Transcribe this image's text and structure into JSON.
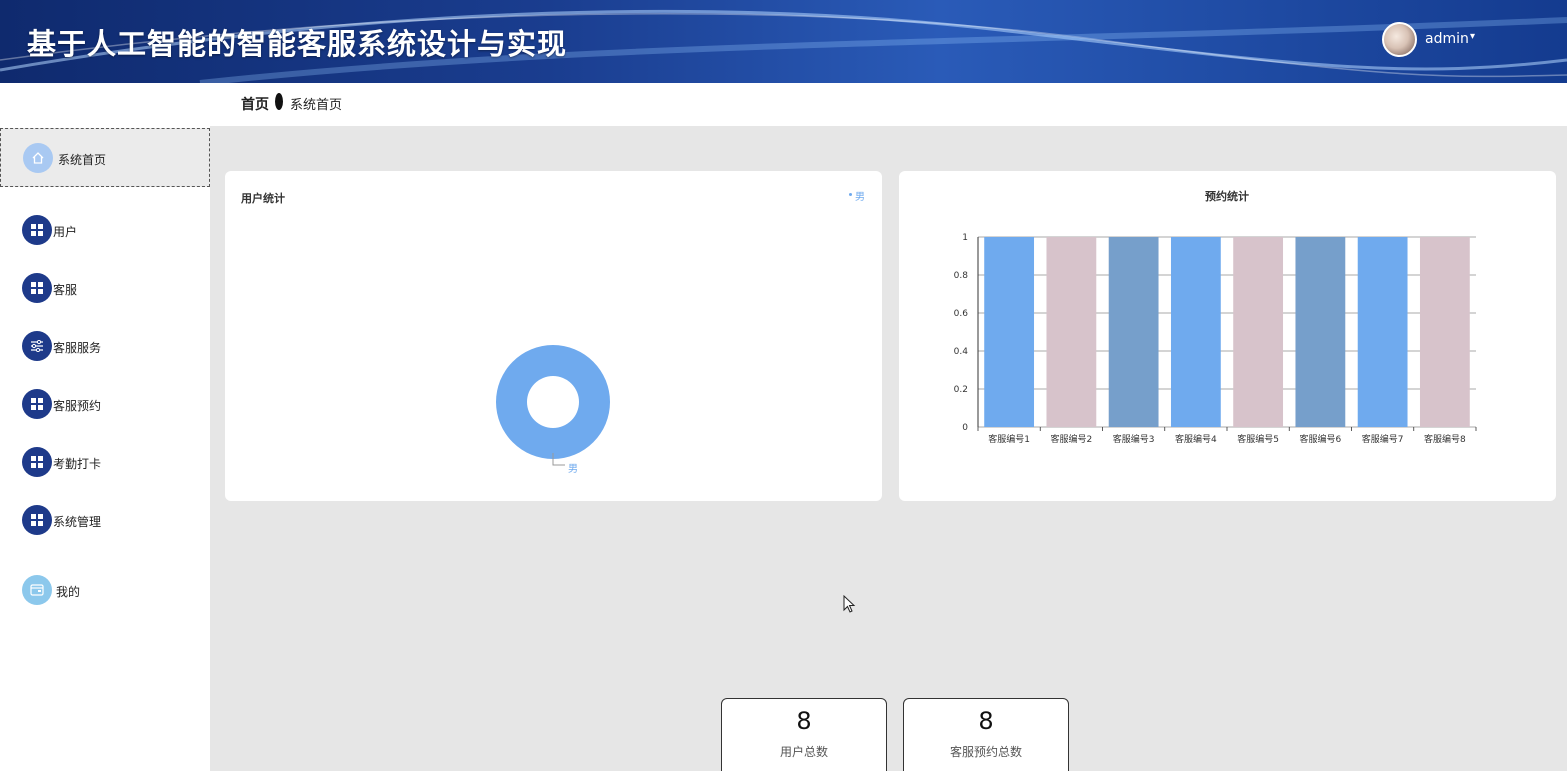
{
  "header": {
    "title": "基于人工智能的智能客服系统设计与实现",
    "user_name": "admin",
    "caret": "▾"
  },
  "breadcrumb": {
    "home": "首页",
    "current": "系统首页"
  },
  "sidebar": {
    "items": [
      {
        "label": "系统首页",
        "icon": "home-icon"
      },
      {
        "label": "用户",
        "icon": "grid-icon"
      },
      {
        "label": "客服",
        "icon": "grid-icon"
      },
      {
        "label": "客服服务",
        "icon": "sliders-icon"
      },
      {
        "label": "客服预约",
        "icon": "grid-icon"
      },
      {
        "label": "考勤打卡",
        "icon": "grid-icon"
      },
      {
        "label": "系统管理",
        "icon": "grid-icon"
      },
      {
        "label": "我的",
        "icon": "wallet-icon"
      }
    ]
  },
  "colors": {
    "header_dark": "#0f2a6e",
    "sidebar_icon": "#1e3a8a",
    "bar_blue": "#6faaee",
    "bar_pink": "#d7c3cb",
    "bar_steel": "#769fcb"
  },
  "user_chart": {
    "title": "用户统计",
    "legend_label": "男",
    "slice_label": "男"
  },
  "stats": [
    {
      "value": "8",
      "label": "用户总数"
    },
    {
      "value": "8",
      "label": "客服预约总数"
    }
  ],
  "chart_data": [
    {
      "type": "pie",
      "title": "用户统计",
      "donut": true,
      "categories": [
        "男"
      ],
      "values": [
        8
      ],
      "legend": "top-right"
    },
    {
      "type": "bar",
      "title": "预约统计",
      "categories": [
        "客服编号1",
        "客服编号2",
        "客服编号3",
        "客服编号4",
        "客服编号5",
        "客服编号6",
        "客服编号7",
        "客服编号8"
      ],
      "values": [
        1,
        1,
        1,
        1,
        1,
        1,
        1,
        1
      ],
      "colors": [
        "#6faaee",
        "#d7c3cb",
        "#769fcb",
        "#6faaee",
        "#d7c3cb",
        "#769fcb",
        "#6faaee",
        "#d7c3cb"
      ],
      "yticks": [
        "0",
        "0.2",
        "0.4",
        "0.6",
        "0.8",
        "1"
      ],
      "ylim": [
        0,
        1
      ],
      "grid": true
    }
  ]
}
